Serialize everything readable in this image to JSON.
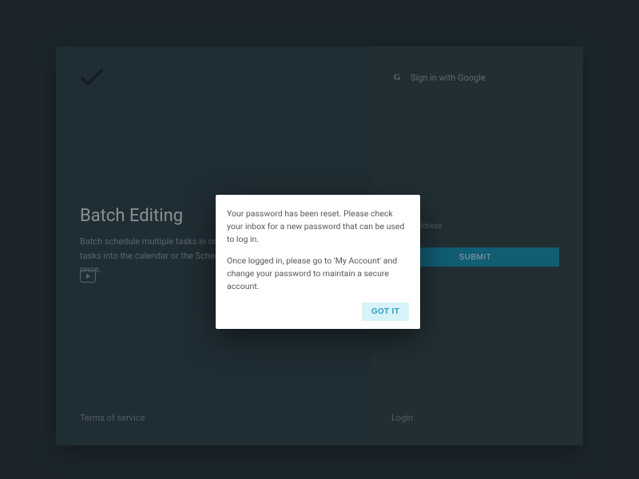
{
  "left": {
    "heading": "Batch Editing",
    "subtext": "Batch schedule multiple tasks in one go. Drag and drop a set of tasks into the calendar or the Scheduled list to schedule them all at once.",
    "tos": "Terms of service"
  },
  "right": {
    "google_label": "Sign in with Google",
    "email_label": "Email Address",
    "submit_label": "SUBMIT",
    "login_link": "Login"
  },
  "dialog": {
    "p1": "Your password has been reset. Please check your inbox for a new password that can be used to log in.",
    "p2": "Once logged in, please go to 'My Account' and change your password to maintain a secure account.",
    "got_it": "GOT IT"
  }
}
